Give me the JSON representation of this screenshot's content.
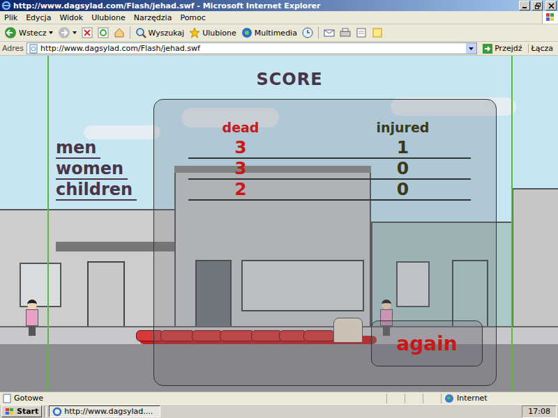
{
  "window": {
    "title": "http://www.dagsylad.com/Flash/jehad.swf - Microsoft Internet Explorer"
  },
  "menu": [
    "Plik",
    "Edycja",
    "Widok",
    "Ulubione",
    "Narzędzia",
    "Pomoc"
  ],
  "toolbar": [
    {
      "label": "Wstecz"
    },
    {
      "label": "Wyszukaj"
    },
    {
      "label": "Ulubione"
    },
    {
      "label": "Multimedia"
    }
  ],
  "address": {
    "label": "Adres",
    "value": "http://www.dagsylad.com/Flash/jehad.swf",
    "go": "Przejdź",
    "links": "Łącza"
  },
  "game": {
    "title": "SCORE",
    "columns": [
      "dead",
      "injured"
    ],
    "rows": [
      {
        "label": "men",
        "dead": "3",
        "injured": "1"
      },
      {
        "label": "women",
        "dead": "3",
        "injured": "0"
      },
      {
        "label": "children",
        "dead": "2",
        "injured": "0"
      }
    ],
    "button": "again"
  },
  "status_bar": {
    "text": "Gotowe",
    "zone": "Internet"
  },
  "taskbar": {
    "start": "Start",
    "task": "http://www.dagsylad....",
    "clock": "17:08"
  }
}
